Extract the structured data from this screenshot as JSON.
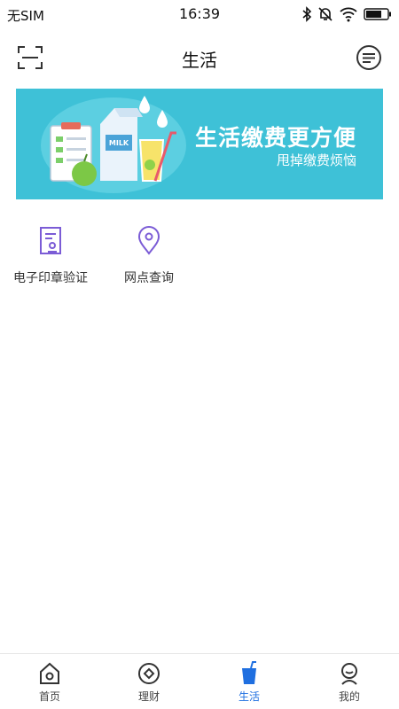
{
  "status_bar": {
    "carrier": "无SIM",
    "time": "16:39",
    "icons": [
      "bluetooth-icon",
      "alarm-off-icon",
      "wifi-icon",
      "battery-icon"
    ]
  },
  "header": {
    "title": "生活",
    "left_icon": "scan-icon",
    "right_icon": "message-icon"
  },
  "banner": {
    "title": "生活缴费更方便",
    "subtitle": "甩掉缴费烦恼",
    "background": "#3ec1d7"
  },
  "shortcuts": [
    {
      "label": "电子印章验证",
      "icon": "stamp-document-icon"
    },
    {
      "label": "网点查询",
      "icon": "location-pin-icon"
    }
  ],
  "shortcut_accent": "#7b5cd6",
  "tab_bar": {
    "active_color": "#1f6fe0",
    "tabs": [
      {
        "label": "首页",
        "icon": "home-icon",
        "active": false
      },
      {
        "label": "理财",
        "icon": "finance-icon",
        "active": false
      },
      {
        "label": "生活",
        "icon": "life-cup-icon",
        "active": true
      },
      {
        "label": "我的",
        "icon": "profile-icon",
        "active": false
      }
    ]
  }
}
